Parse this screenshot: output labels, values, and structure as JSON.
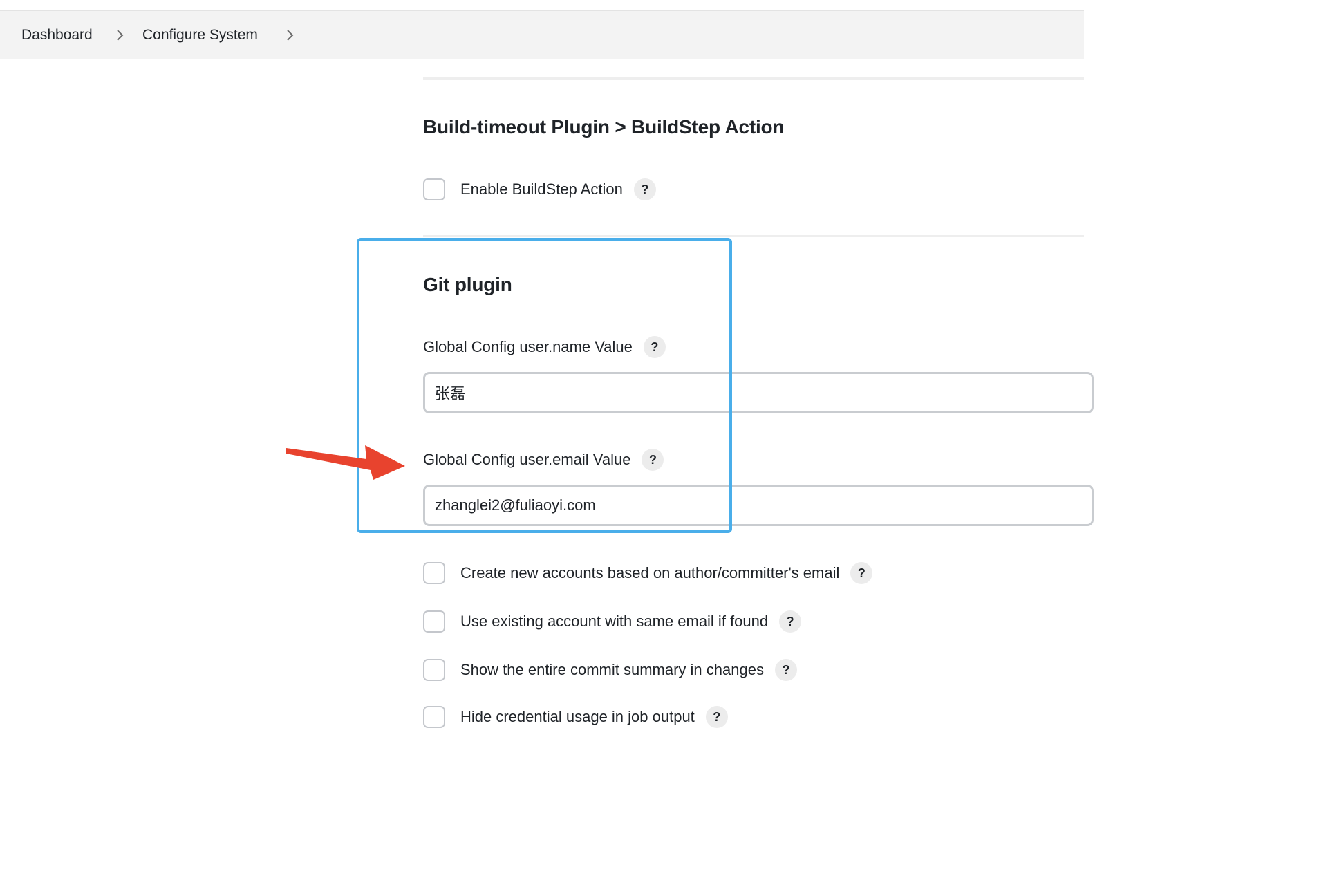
{
  "breadcrumb": {
    "items": [
      "Dashboard",
      "Configure System"
    ]
  },
  "buildtimeout": {
    "title": "Build-timeout Plugin > BuildStep Action",
    "enable_label": "Enable BuildStep Action",
    "enable_checked": false
  },
  "git": {
    "title": "Git plugin",
    "username_label": "Global Config user.name Value",
    "username_value": "张磊",
    "email_label": "Global Config user.email Value",
    "email_value": "zhanglei2@fuliaoyi.com",
    "options": [
      {
        "label": "Create new accounts based on author/committer's email",
        "checked": false
      },
      {
        "label": "Use existing account with same email if found",
        "checked": false
      },
      {
        "label": "Show the entire commit summary in changes",
        "checked": false
      },
      {
        "label": "Hide credential usage in job output",
        "checked": false
      }
    ]
  },
  "help_glyph": "?",
  "icons": {
    "breadcrumb_separator": "chevron-right-icon",
    "help": "help-icon",
    "annotation": "red-arrow-icon"
  },
  "colors": {
    "highlight_box": "#4aaeea",
    "annotation_arrow": "#e8432e",
    "breadcrumb_bg": "#f3f3f3"
  }
}
